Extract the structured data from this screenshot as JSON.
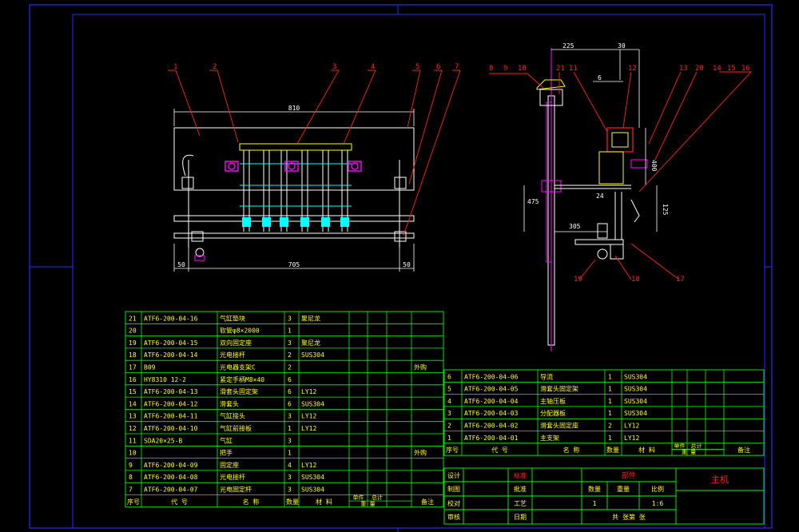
{
  "colors": {
    "background": "#000000",
    "frame": "#2a2aff",
    "outline": "#ffffff",
    "table_grid": "#00ff00",
    "table_text": "#ffff00",
    "table_text_alt": "#ff4040",
    "leader": "#ff2020",
    "dim": "#ffffff",
    "part_cyan": "#00ffff",
    "part_magenta": "#ff00ff",
    "part_yellow": "#ffff00"
  },
  "front_view": {
    "balloons": [
      "1",
      "2",
      "3",
      "4",
      "5",
      "6",
      "7"
    ],
    "dims": {
      "top": "810",
      "left": "50",
      "middle": "705",
      "right": "50"
    }
  },
  "side_view": {
    "balloons_top": [
      "8",
      "9",
      "10",
      "21",
      "11",
      "12",
      "13",
      "20",
      "14",
      "15",
      "16"
    ],
    "balloons_bottom": [
      "19",
      "18",
      "17"
    ],
    "dims": {
      "d225": "225",
      "d30": "30",
      "d6": "6",
      "d400": "400",
      "d24": "24",
      "d475": "475",
      "d125": "125",
      "d305": "305"
    }
  },
  "bom_left": {
    "rows": [
      {
        "no": "21",
        "code": "ATF6-200-04-16",
        "name": "气缸垫块",
        "qty": "3",
        "mat": "聚尼龙",
        "note": ""
      },
      {
        "no": "20",
        "code": "",
        "name": "软管φ8×2000",
        "qty": "1",
        "mat": "",
        "note": ""
      },
      {
        "no": "19",
        "code": "ATF6-200-04-15",
        "name": "双向固定座",
        "qty": "3",
        "mat": "聚尼龙",
        "note": ""
      },
      {
        "no": "18",
        "code": "ATF6-200-04-14",
        "name": "光电接杆",
        "qty": "2",
        "mat": "SUS304",
        "note": ""
      },
      {
        "no": "17",
        "code": "B09",
        "name": "光电器支架C",
        "qty": "2",
        "mat": "",
        "note": "外购"
      },
      {
        "no": "16",
        "code": "HY8310 12-2",
        "name": "紧定手柄M8×40",
        "qty": "6",
        "mat": "",
        "note": ""
      },
      {
        "no": "15",
        "code": "ATF6-200-04-13",
        "name": "滑套头固定架",
        "qty": "6",
        "mat": "LY12",
        "note": ""
      },
      {
        "no": "14",
        "code": "ATF6-200-04-12",
        "name": "滑套头",
        "qty": "6",
        "mat": "SUS304",
        "note": ""
      },
      {
        "no": "13",
        "code": "ATF6-200-04-11",
        "name": "气缸接头",
        "qty": "3",
        "mat": "LY12",
        "note": ""
      },
      {
        "no": "12",
        "code": "ATF6-200-04-10",
        "name": "气缸前接板",
        "qty": "1",
        "mat": "LY12",
        "note": ""
      },
      {
        "no": "11",
        "code": "SDA20×25-B",
        "name": "气缸",
        "qty": "3",
        "mat": "",
        "note": ""
      },
      {
        "no": "10",
        "code": "",
        "name": "把手",
        "qty": "1",
        "mat": "",
        "note": "外购"
      },
      {
        "no": "9",
        "code": "ATF6-200-04-09",
        "name": "固定座",
        "qty": "4",
        "mat": "LY12",
        "note": ""
      },
      {
        "no": "8",
        "code": "ATF6-200-04-08",
        "name": "光电接杆",
        "qty": "3",
        "mat": "SUS304",
        "note": ""
      },
      {
        "no": "7",
        "code": "ATF6-200-04-07",
        "name": "光电固定杆",
        "qty": "3",
        "mat": "SUS304",
        "note": ""
      }
    ],
    "header": {
      "no": "序号",
      "code": "代    号",
      "name": "名    称",
      "qty": "数量",
      "mat": "材    料",
      "unit": "单件",
      "total": "总计",
      "weight": "重    量",
      "note": "备注"
    }
  },
  "bom_right": {
    "rows": [
      {
        "no": "6",
        "code": "ATF6-200-04-06",
        "name": "导流",
        "qty": "1",
        "mat": "SUS304",
        "note": ""
      },
      {
        "no": "5",
        "code": "ATF6-200-04-05",
        "name": "滑套头固定架",
        "qty": "1",
        "mat": "SUS304",
        "note": ""
      },
      {
        "no": "4",
        "code": "ATF6-200-04-04",
        "name": "主轴压板",
        "qty": "1",
        "mat": "SUS304",
        "note": ""
      },
      {
        "no": "3",
        "code": "ATF6-200-04-03",
        "name": "分配器板",
        "qty": "1",
        "mat": "SUS304",
        "note": ""
      },
      {
        "no": "2",
        "code": "ATF6-200-04-02",
        "name": "滑套头固定座",
        "qty": "2",
        "mat": "LY12",
        "note": ""
      },
      {
        "no": "1",
        "code": "ATF6-200-04-01",
        "name": "主支架",
        "qty": "1",
        "mat": "LY12",
        "note": ""
      }
    ],
    "header": {
      "no": "序号",
      "code": "代    号",
      "name": "名    称",
      "qty": "数量",
      "mat": "材    料",
      "unit": "单件",
      "total": "总计",
      "weight": "重    量",
      "note": "备注"
    }
  },
  "title_block": {
    "design": "设计",
    "draw": "制图",
    "check": "校对",
    "review": "审核",
    "std": "标准",
    "approve": "批准",
    "process": "工艺",
    "date": "日期",
    "assembly": "部件",
    "qty": "数量",
    "weight": "重量",
    "scale": "比例",
    "qty_val": "1",
    "scale_val": "1:6",
    "sheets": "共    张第    张",
    "title": "主机"
  }
}
